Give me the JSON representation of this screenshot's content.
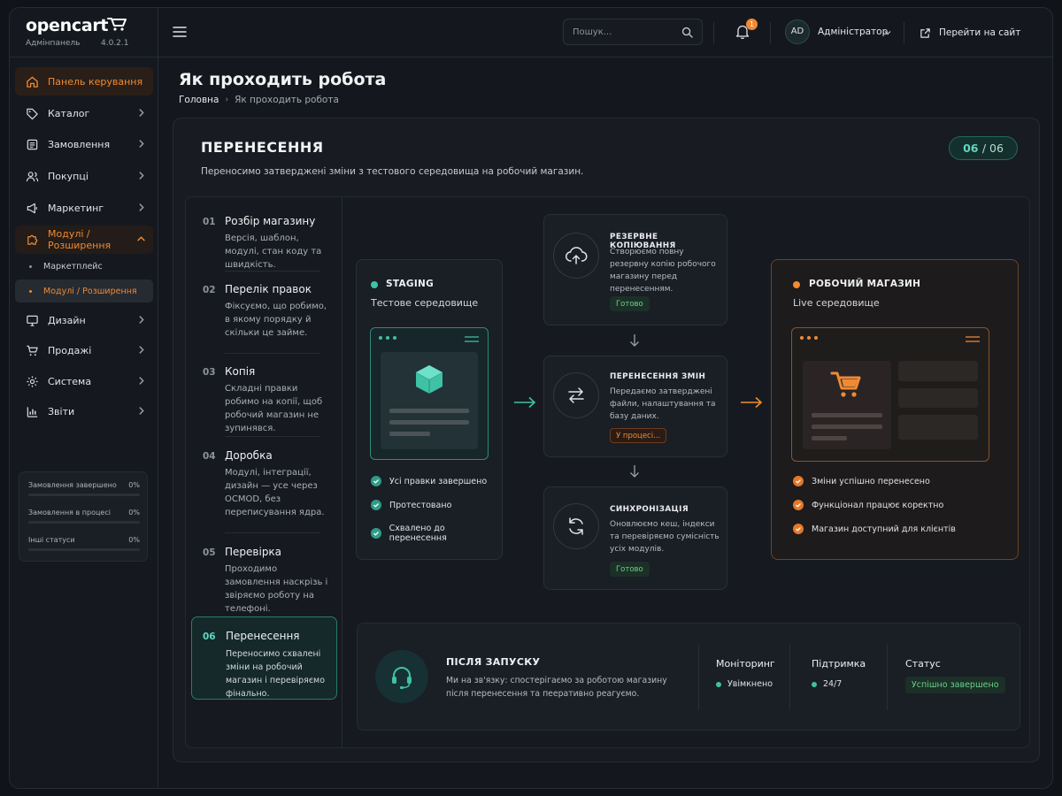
{
  "brand": {
    "name": "opencart",
    "subtitle": "Адмінпанель",
    "version": "4.0.2.1"
  },
  "sidebar": {
    "items": [
      {
        "label": "Панель керування",
        "icon": "home-icon"
      },
      {
        "label": "Каталог",
        "icon": "tag-icon"
      },
      {
        "label": "Замовлення",
        "icon": "orders-icon"
      },
      {
        "label": "Покупці",
        "icon": "users-icon"
      },
      {
        "label": "Маркетинг",
        "icon": "megaphone-icon"
      },
      {
        "label": "Модулі / Розширення",
        "icon": "puzzle-icon"
      },
      {
        "label": "Дизайн",
        "icon": "monitor-icon"
      },
      {
        "label": "Продажі",
        "icon": "cart-icon"
      },
      {
        "label": "Система",
        "icon": "gear-icon"
      },
      {
        "label": "Звіти",
        "icon": "chart-icon"
      }
    ],
    "subitems": [
      {
        "label": "Маркетплейс"
      },
      {
        "label": "Модулі / Розширення"
      }
    ],
    "stats": [
      {
        "label": "Замовлення завершено",
        "value": "0%",
        "fill": 0
      },
      {
        "label": "Замовлення в процесі",
        "value": "0%",
        "fill": 0
      },
      {
        "label": "Інші статуси",
        "value": "0%",
        "fill": 0
      }
    ]
  },
  "topbar": {
    "search_placeholder": "Пошук...",
    "notifications_count": "1",
    "avatar_initials": "AD",
    "user_name": "Адміністратор",
    "goto_site": "Перейти на сайт"
  },
  "page": {
    "title": "Як проходить робота",
    "breadcrumb": {
      "home": "Головна",
      "current": "Як проходить робота"
    }
  },
  "card": {
    "title": "ПЕРЕНЕСЕННЯ",
    "description": "Переносимо затверджені зміни з тестового середовища на робочий магазин.",
    "step_current": "06",
    "step_total": "06"
  },
  "steps": [
    {
      "num": "01",
      "name": "Розбір магазину",
      "text": "Версія, шаблон, модулі, стан коду та швидкість."
    },
    {
      "num": "02",
      "name": "Перелік правок",
      "text": "Фіксуємо, що робимо, в якому порядку й скільки це займе."
    },
    {
      "num": "03",
      "name": "Копія",
      "text": "Складні правки робимо на копії, щоб робочий магазин не зупинявся."
    },
    {
      "num": "04",
      "name": "Доробка",
      "text": "Модулі, інтеграції, дизайн — усе через OCMOD, без переписування ядра."
    },
    {
      "num": "05",
      "name": "Перевірка",
      "text": "Проходимо замовлення наскрізь і звіряємо роботу на телефоні."
    },
    {
      "num": "06",
      "name": "Перенесення",
      "text": "Переносимо схвалені зміни на робочий магазин і перевіряємо фінально."
    }
  ],
  "staging": {
    "title": "STAGING",
    "subtitle": "Тестове середовище",
    "checks": [
      "Усі правки завершено",
      "Протестовано",
      "Схвалено до перенесення"
    ]
  },
  "pipeline": [
    {
      "title": "РЕЗЕРВНЕ КОПІЮВАННЯ",
      "text": "Створюємо повну резервну копію робочого магазину перед перенесенням.",
      "status": "Готово",
      "icon": "cloud-upload-icon"
    },
    {
      "title": "ПЕРЕНЕСЕННЯ ЗМІН",
      "text": "Передаємо затверджені файли, налаштування та базу даних.",
      "status": "У процесі...",
      "icon": "transfer-icon"
    },
    {
      "title": "СИНХРОНІЗАЦІЯ",
      "text": "Оновлюємо кеш, індекси та перевіряємо сумісність усіх модулів.",
      "status": "Готово",
      "icon": "sync-icon"
    }
  ],
  "live": {
    "title": "РОБОЧИЙ МАГАЗИН",
    "subtitle": "Live середовище",
    "checks": [
      "Зміни успішно перенесено",
      "Функціонал працює коректно",
      "Магазин доступний для клієнтів"
    ]
  },
  "after": {
    "title": "ПІСЛЯ ЗАПУСКУ",
    "text": "Ми на зв'язку: спостерігаємо за роботою магазину після перенесення та пееративно реагуємо.",
    "monitoring_label": "Моніторинг",
    "monitoring_value": "Увімкнено",
    "support_label": "Підтримка",
    "support_value": "24/7",
    "status_label": "Статус",
    "status_value": "Успішно завершено"
  },
  "colors": {
    "accent": "#f08a34",
    "teal": "#3fc1a6",
    "bg": "#14181e"
  }
}
